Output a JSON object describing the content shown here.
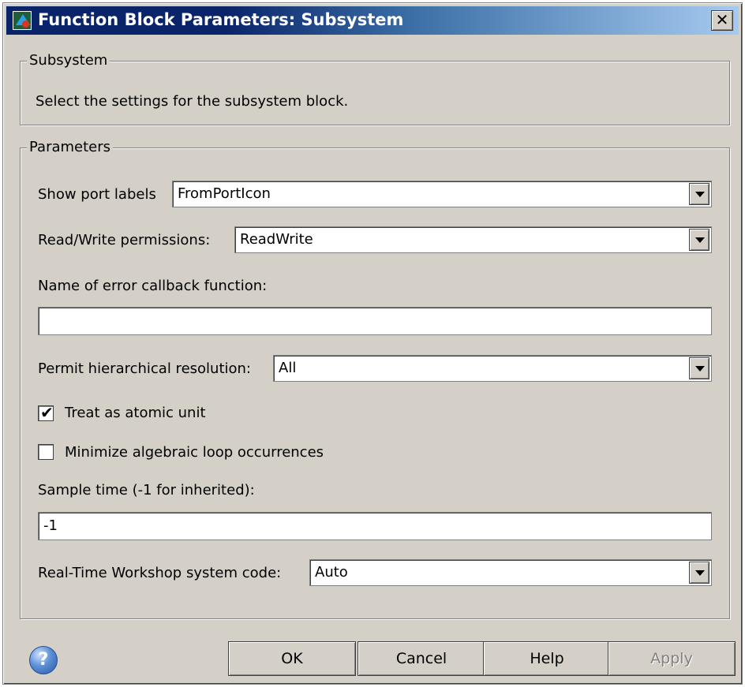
{
  "window": {
    "title": "Function Block Parameters: Subsystem",
    "close_label": "✕"
  },
  "subsystem_group": {
    "legend": "Subsystem",
    "description": "Select the settings for the subsystem block."
  },
  "parameters_group": {
    "legend": "Parameters",
    "show_port_labels": {
      "label": "Show port labels",
      "value": "FromPortIcon"
    },
    "read_write_permissions": {
      "label": "Read/Write permissions:",
      "value": "ReadWrite"
    },
    "error_callback": {
      "label": "Name of error callback function:",
      "value": ""
    },
    "hierarchical_resolution": {
      "label": "Permit hierarchical resolution:",
      "value": "All"
    },
    "treat_atomic": {
      "label": "Treat as atomic unit",
      "checked": true,
      "check_glyph": "✔"
    },
    "minimize_loop": {
      "label": "Minimize algebraic loop occurrences",
      "checked": false
    },
    "sample_time": {
      "label": "Sample time (-1 for inherited):",
      "value": "-1"
    },
    "rtw_system_code": {
      "label": "Real-Time Workshop system code:",
      "value": "Auto"
    }
  },
  "buttons": {
    "help_icon": "?",
    "ok": "OK",
    "cancel": "Cancel",
    "help": "Help",
    "apply": "Apply"
  },
  "icons": {
    "app": "simulink-block-icon",
    "close": "close-icon",
    "dropdown": "chevron-down-icon",
    "help": "help-icon"
  }
}
